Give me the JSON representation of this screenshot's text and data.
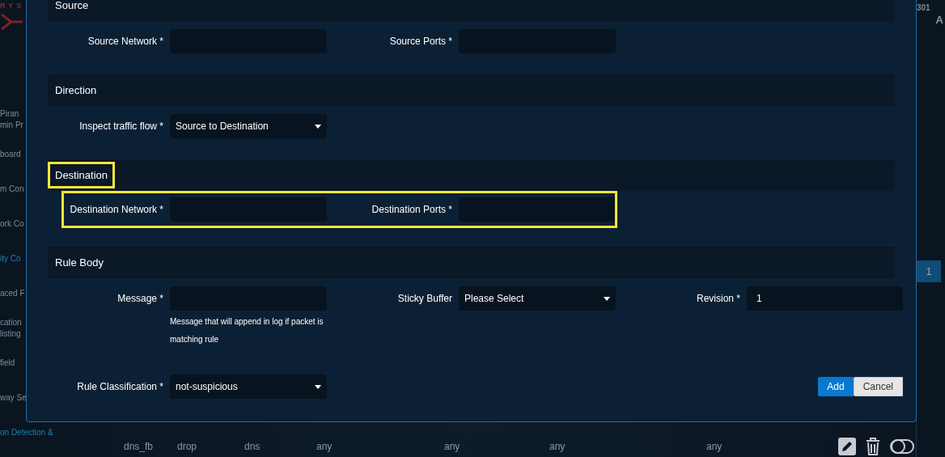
{
  "sidebar": {
    "logo": "RYS",
    "items": [
      {
        "label": "Piran\nmin Pr",
        "selected": false
      },
      {
        "label": "board",
        "selected": false
      },
      {
        "label": "m Con",
        "selected": false
      },
      {
        "label": "ork Co",
        "selected": false
      },
      {
        "label": "ity Co",
        "selected": true
      },
      {
        "label": "aced F",
        "selected": false
      },
      {
        "label": "cation\nlisting",
        "selected": false
      },
      {
        "label": "field",
        "selected": false
      },
      {
        "label": "way Se",
        "selected": false
      },
      {
        "label": "on Detection &",
        "selected": true
      }
    ]
  },
  "header": {
    "counter": "301",
    "user_initial": "A"
  },
  "pagination": {
    "pages": [
      {
        "label": "1",
        "selected": true
      }
    ]
  },
  "table": {
    "rows": [
      {
        "cells": [
          "dns_fb",
          "drop",
          "dns",
          "any",
          "any",
          "any",
          "any"
        ]
      }
    ]
  },
  "modal": {
    "sections": [
      {
        "title": "Source",
        "highlighted": false,
        "rows": [
          {
            "highlighted": false,
            "fields": [
              {
                "label": "Source Network *",
                "kind": "text"
              },
              {
                "label": "Source Ports *",
                "kind": "text"
              }
            ]
          }
        ]
      },
      {
        "title": "Direction",
        "highlighted": false,
        "rows": [
          {
            "highlighted": false,
            "fields": [
              {
                "label": "Inspect traffic flow *",
                "kind": "select",
                "value": "Source to Destination"
              }
            ]
          }
        ]
      },
      {
        "title": "Destination",
        "highlighted": true,
        "rows": [
          {
            "highlighted": true,
            "fields": [
              {
                "label": "Destination Network *",
                "kind": "text"
              },
              {
                "label": "Destination Ports *",
                "kind": "text"
              }
            ]
          }
        ]
      },
      {
        "title": "Rule Body",
        "highlighted": false,
        "rows": [
          {
            "highlighted": false,
            "fields": [
              {
                "label": "Message *",
                "kind": "text",
                "hint": "Message that will append in log if packet is matching rule"
              },
              {
                "label": "Sticky Buffer",
                "kind": "select",
                "value": "Please Select"
              },
              {
                "label": "Revision *",
                "kind": "text",
                "value": "1"
              }
            ]
          },
          {
            "highlighted": false,
            "fields": [
              {
                "label": "Rule Classification *",
                "kind": "select",
                "value": "not-suspicious"
              }
            ]
          }
        ]
      }
    ],
    "buttons": [
      {
        "label": "Add",
        "kind": "primary"
      },
      {
        "label": "Cancel",
        "kind": "secondary"
      }
    ]
  }
}
